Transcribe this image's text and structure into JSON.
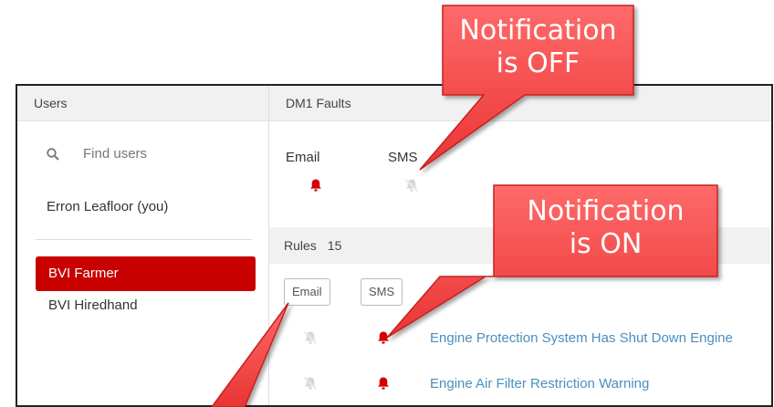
{
  "users_panel": {
    "header": "Users",
    "search_placeholder": "Find users",
    "current_user": "Erron Leafloor (you)",
    "groups": [
      {
        "label": "BVI Farmer",
        "active": true
      },
      {
        "label": "BVI Hiredhand",
        "active": false
      }
    ]
  },
  "faults_panel": {
    "header": "DM1 Faults",
    "email_label": "Email",
    "sms_label": "SMS",
    "email_on": true,
    "sms_on": false
  },
  "rules_panel": {
    "header": "Rules",
    "count": "15",
    "email_chip": "Email",
    "sms_chip": "SMS",
    "rules": [
      {
        "name": "Engine Protection System Has Shut Down Engine",
        "email_on": false,
        "sms_on": true
      },
      {
        "name": "Engine Air Filter Restriction Warning",
        "email_on": false,
        "sms_on": true
      }
    ]
  },
  "callouts": {
    "off": {
      "line1": "Notification",
      "line2": "is OFF"
    },
    "on": {
      "line1": "Notification",
      "line2": "is ON"
    }
  },
  "colors": {
    "accent_red": "#c80000",
    "bell_on": "#d40000",
    "bell_off": "#d6d6d6",
    "link_blue": "#4a8fbd",
    "callout_fill": "#f04545"
  }
}
